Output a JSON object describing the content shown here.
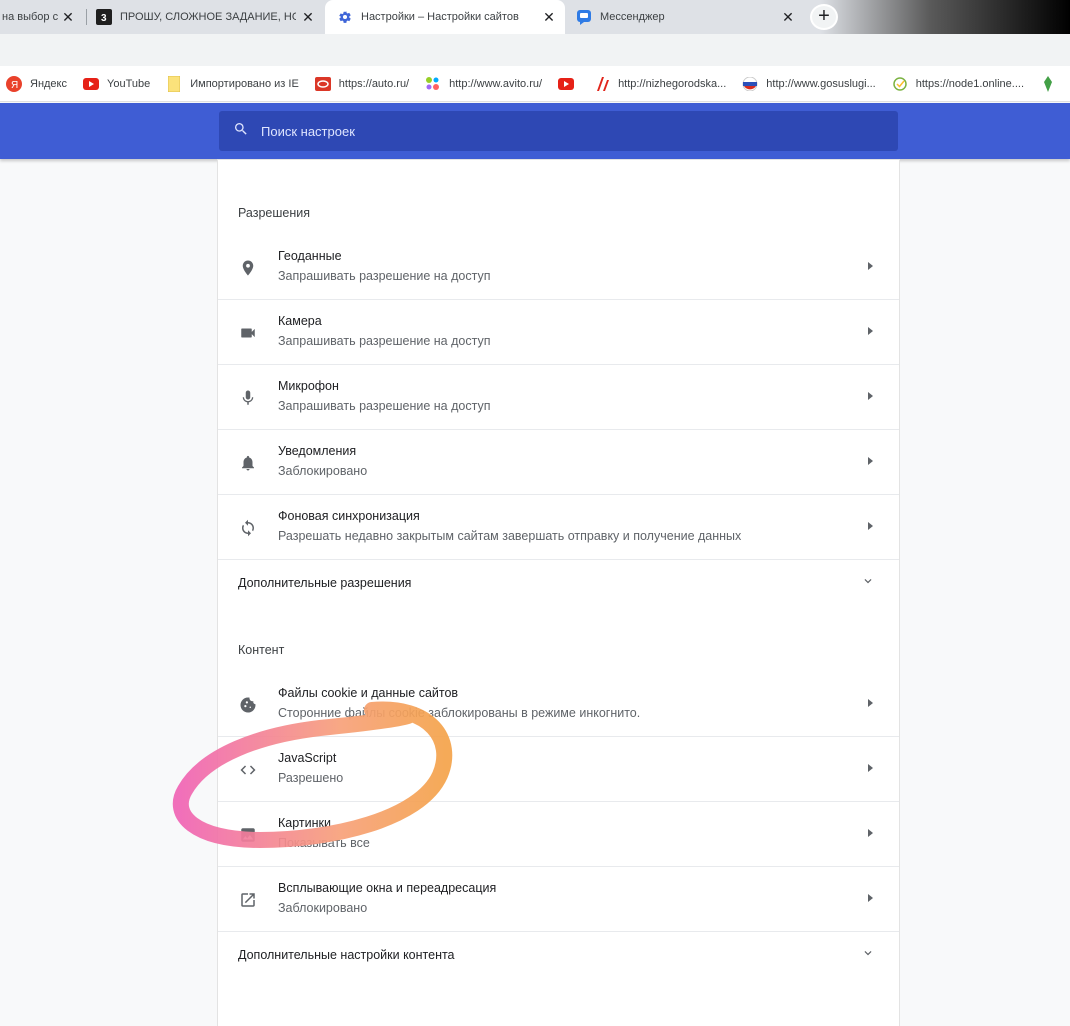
{
  "tabs": [
    {
      "title": "на выбор с",
      "favicon": "none"
    },
    {
      "title": "ПРОШУ, СЛОЖНОЕ ЗАДАНИЕ, НО",
      "favicon": "znanija-icon"
    },
    {
      "title": "Настройки – Настройки сайтов",
      "favicon": "gear-icon"
    },
    {
      "title": "Мессенджер",
      "favicon": "messenger-icon"
    }
  ],
  "bookmarks": [
    {
      "label": "Яндекс",
      "icon": "yandex-icon"
    },
    {
      "label": "YouTube",
      "icon": "youtube-icon"
    },
    {
      "label": "Импортировано из IE",
      "icon": "folder-icon"
    },
    {
      "label": "https://auto.ru/",
      "icon": "auto-ru-icon"
    },
    {
      "label": "http://www.avito.ru/",
      "icon": "avito-icon"
    },
    {
      "label": "",
      "icon": "youtube-icon"
    },
    {
      "label": "http://nizhegorodska...",
      "icon": "nizhegorod-icon"
    },
    {
      "label": "http://www.gosuslugi...",
      "icon": "flag-icon"
    },
    {
      "label": "https://node1.online....",
      "icon": "check-icon"
    }
  ],
  "search": {
    "placeholder": "Поиск настроек"
  },
  "permissions": {
    "heading": "Разрешения",
    "items": [
      {
        "title": "Геоданные",
        "sub": "Запрашивать разрешение на доступ",
        "icon": "location-icon"
      },
      {
        "title": "Камера",
        "sub": "Запрашивать разрешение на доступ",
        "icon": "camera-icon"
      },
      {
        "title": "Микрофон",
        "sub": "Запрашивать разрешение на доступ",
        "icon": "microphone-icon"
      },
      {
        "title": "Уведомления",
        "sub": "Заблокировано",
        "icon": "bell-icon"
      },
      {
        "title": "Фоновая синхронизация",
        "sub": "Разрешать недавно закрытым сайтам завершать отправку и получение данных",
        "icon": "sync-icon"
      }
    ],
    "more": "Дополнительные разрешения"
  },
  "content": {
    "heading": "Контент",
    "items": [
      {
        "title": "Файлы cookie и данные сайтов",
        "sub": "Сторонние файлы cookie заблокированы в режиме инкогнито.",
        "icon": "cookie-icon"
      },
      {
        "title": "JavaScript",
        "sub": "Разрешено",
        "icon": "code-icon"
      },
      {
        "title": "Картинки",
        "sub": "Показывать все",
        "icon": "image-icon"
      },
      {
        "title": "Всплывающие окна и переадресация",
        "sub": "Заблокировано",
        "icon": "open-in-new-icon"
      }
    ],
    "more": "Дополнительные настройки контента"
  },
  "colors": {
    "header": "#3f5dd4",
    "annotation_stroke": "#f06a9c"
  }
}
